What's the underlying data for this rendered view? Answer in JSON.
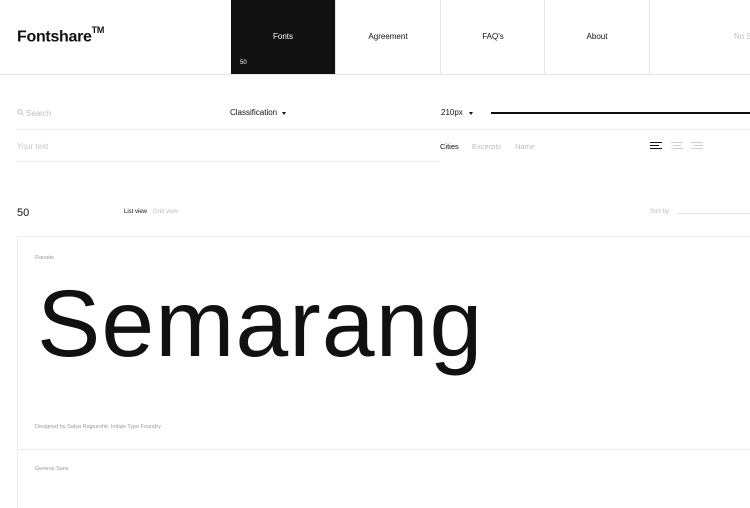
{
  "header": {
    "logo": "Fontshare",
    "logo_tm": "TM",
    "nav": [
      {
        "label": "Fonts",
        "count": "50",
        "active": true
      },
      {
        "label": "Agreement"
      },
      {
        "label": "FAQ's"
      },
      {
        "label": "About"
      },
      {
        "label": "No Sl"
      }
    ]
  },
  "filters": {
    "search_placeholder": "Search",
    "classification_label": "Classification",
    "size_label": "210px",
    "text_placeholder": "Your text",
    "sample_tabs": [
      "Cities",
      "Excerpts",
      "Name"
    ],
    "active_sample_tab": "Cities"
  },
  "list": {
    "count": "50",
    "views": [
      "List view",
      "Grid view"
    ],
    "active_view": "List view",
    "sort_label": "Sort by"
  },
  "fonts": [
    {
      "category": "Ranade",
      "specimen": "Semarang",
      "designer": "Designed by Satya Rajpurohit, Indian Type Foundry"
    },
    {
      "category": "General Sans"
    }
  ],
  "colors": {
    "text": "#111111",
    "muted": "#bdbdbd",
    "nav_active_bg": "#111111",
    "border": "#e6e6e6"
  }
}
